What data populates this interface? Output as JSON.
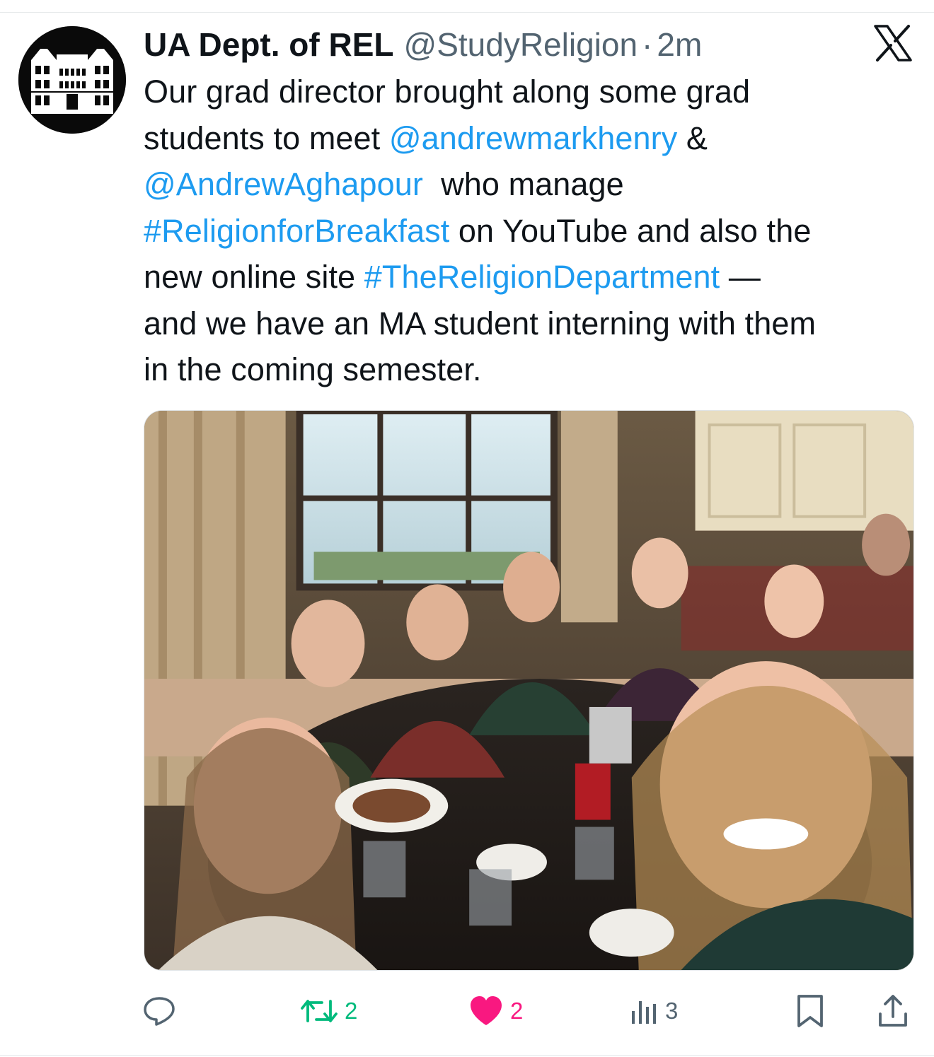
{
  "author": {
    "name": "UA Dept. of REL",
    "handle": "@StudyReligion",
    "separator": "·",
    "time": "2m",
    "avatar_icon": "building-facade-icon"
  },
  "platform_icon": "x-logo-icon",
  "tweet": {
    "lines": [
      [
        {
          "t": "Our grad director brought along some grad"
        }
      ],
      [
        {
          "t": "students to meet "
        },
        {
          "t": "@andrewmarkhenry",
          "link": true
        },
        {
          "t": " &"
        }
      ],
      [
        {
          "t": "@AndrewAghapour",
          "link": true
        },
        {
          "t": "  who manage"
        }
      ],
      [
        {
          "t": "#ReligionforBreakfast",
          "link": true
        },
        {
          "t": " on YouTube and also the"
        }
      ],
      [
        {
          "t": "new online site "
        },
        {
          "t": "#TheReligionDepartment",
          "link": true
        },
        {
          "t": " —"
        }
      ],
      [
        {
          "t": "and we have an MA student interning with them"
        }
      ],
      [
        {
          "t": "in the coming semester."
        }
      ]
    ]
  },
  "media": {
    "alt_icon": "group-selfie-photo"
  },
  "metrics": {
    "reply_icon": "reply-icon",
    "retweets": "2",
    "retweet_icon": "retweet-icon",
    "likes": "2",
    "like_icon": "heart-icon",
    "liked": true,
    "views": "3",
    "views_icon": "analytics-icon",
    "bookmark_icon": "bookmark-icon",
    "share_icon": "share-icon"
  },
  "colors": {
    "link": "#1d9bf0",
    "retweet": "#00ba7c",
    "like": "#f91880",
    "muted": "#536471",
    "text": "#0f1419"
  }
}
